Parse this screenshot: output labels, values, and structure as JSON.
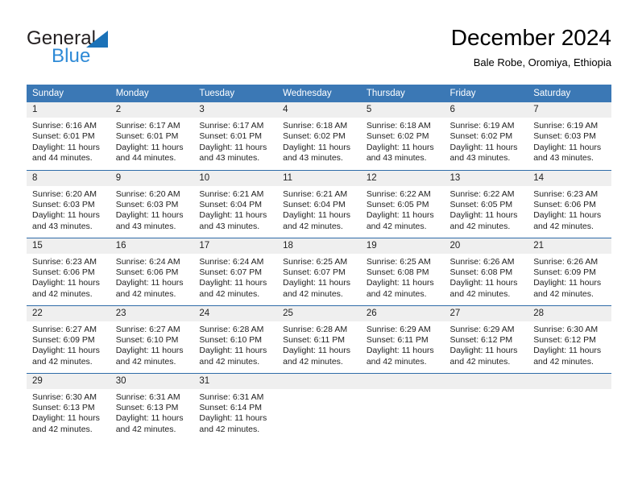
{
  "brand": {
    "name_part1": "General",
    "name_part2": "Blue"
  },
  "header": {
    "title": "December 2024",
    "subtitle": "Bale Robe, Oromiya, Ethiopia"
  },
  "colors": {
    "header_blue": "#3b78b5",
    "row_divider": "#2f6ca8",
    "daynum_bg": "#efefef",
    "brand_blue": "#2e8ad6",
    "triangle_blue": "#1b72b8"
  },
  "weekdays": [
    "Sunday",
    "Monday",
    "Tuesday",
    "Wednesday",
    "Thursday",
    "Friday",
    "Saturday"
  ],
  "weeks": [
    [
      {
        "day": "1",
        "sunrise": "Sunrise: 6:16 AM",
        "sunset": "Sunset: 6:01 PM",
        "daylight1": "Daylight: 11 hours",
        "daylight2": "and 44 minutes."
      },
      {
        "day": "2",
        "sunrise": "Sunrise: 6:17 AM",
        "sunset": "Sunset: 6:01 PM",
        "daylight1": "Daylight: 11 hours",
        "daylight2": "and 44 minutes."
      },
      {
        "day": "3",
        "sunrise": "Sunrise: 6:17 AM",
        "sunset": "Sunset: 6:01 PM",
        "daylight1": "Daylight: 11 hours",
        "daylight2": "and 43 minutes."
      },
      {
        "day": "4",
        "sunrise": "Sunrise: 6:18 AM",
        "sunset": "Sunset: 6:02 PM",
        "daylight1": "Daylight: 11 hours",
        "daylight2": "and 43 minutes."
      },
      {
        "day": "5",
        "sunrise": "Sunrise: 6:18 AM",
        "sunset": "Sunset: 6:02 PM",
        "daylight1": "Daylight: 11 hours",
        "daylight2": "and 43 minutes."
      },
      {
        "day": "6",
        "sunrise": "Sunrise: 6:19 AM",
        "sunset": "Sunset: 6:02 PM",
        "daylight1": "Daylight: 11 hours",
        "daylight2": "and 43 minutes."
      },
      {
        "day": "7",
        "sunrise": "Sunrise: 6:19 AM",
        "sunset": "Sunset: 6:03 PM",
        "daylight1": "Daylight: 11 hours",
        "daylight2": "and 43 minutes."
      }
    ],
    [
      {
        "day": "8",
        "sunrise": "Sunrise: 6:20 AM",
        "sunset": "Sunset: 6:03 PM",
        "daylight1": "Daylight: 11 hours",
        "daylight2": "and 43 minutes."
      },
      {
        "day": "9",
        "sunrise": "Sunrise: 6:20 AM",
        "sunset": "Sunset: 6:03 PM",
        "daylight1": "Daylight: 11 hours",
        "daylight2": "and 43 minutes."
      },
      {
        "day": "10",
        "sunrise": "Sunrise: 6:21 AM",
        "sunset": "Sunset: 6:04 PM",
        "daylight1": "Daylight: 11 hours",
        "daylight2": "and 43 minutes."
      },
      {
        "day": "11",
        "sunrise": "Sunrise: 6:21 AM",
        "sunset": "Sunset: 6:04 PM",
        "daylight1": "Daylight: 11 hours",
        "daylight2": "and 42 minutes."
      },
      {
        "day": "12",
        "sunrise": "Sunrise: 6:22 AM",
        "sunset": "Sunset: 6:05 PM",
        "daylight1": "Daylight: 11 hours",
        "daylight2": "and 42 minutes."
      },
      {
        "day": "13",
        "sunrise": "Sunrise: 6:22 AM",
        "sunset": "Sunset: 6:05 PM",
        "daylight1": "Daylight: 11 hours",
        "daylight2": "and 42 minutes."
      },
      {
        "day": "14",
        "sunrise": "Sunrise: 6:23 AM",
        "sunset": "Sunset: 6:06 PM",
        "daylight1": "Daylight: 11 hours",
        "daylight2": "and 42 minutes."
      }
    ],
    [
      {
        "day": "15",
        "sunrise": "Sunrise: 6:23 AM",
        "sunset": "Sunset: 6:06 PM",
        "daylight1": "Daylight: 11 hours",
        "daylight2": "and 42 minutes."
      },
      {
        "day": "16",
        "sunrise": "Sunrise: 6:24 AM",
        "sunset": "Sunset: 6:06 PM",
        "daylight1": "Daylight: 11 hours",
        "daylight2": "and 42 minutes."
      },
      {
        "day": "17",
        "sunrise": "Sunrise: 6:24 AM",
        "sunset": "Sunset: 6:07 PM",
        "daylight1": "Daylight: 11 hours",
        "daylight2": "and 42 minutes."
      },
      {
        "day": "18",
        "sunrise": "Sunrise: 6:25 AM",
        "sunset": "Sunset: 6:07 PM",
        "daylight1": "Daylight: 11 hours",
        "daylight2": "and 42 minutes."
      },
      {
        "day": "19",
        "sunrise": "Sunrise: 6:25 AM",
        "sunset": "Sunset: 6:08 PM",
        "daylight1": "Daylight: 11 hours",
        "daylight2": "and 42 minutes."
      },
      {
        "day": "20",
        "sunrise": "Sunrise: 6:26 AM",
        "sunset": "Sunset: 6:08 PM",
        "daylight1": "Daylight: 11 hours",
        "daylight2": "and 42 minutes."
      },
      {
        "day": "21",
        "sunrise": "Sunrise: 6:26 AM",
        "sunset": "Sunset: 6:09 PM",
        "daylight1": "Daylight: 11 hours",
        "daylight2": "and 42 minutes."
      }
    ],
    [
      {
        "day": "22",
        "sunrise": "Sunrise: 6:27 AM",
        "sunset": "Sunset: 6:09 PM",
        "daylight1": "Daylight: 11 hours",
        "daylight2": "and 42 minutes."
      },
      {
        "day": "23",
        "sunrise": "Sunrise: 6:27 AM",
        "sunset": "Sunset: 6:10 PM",
        "daylight1": "Daylight: 11 hours",
        "daylight2": "and 42 minutes."
      },
      {
        "day": "24",
        "sunrise": "Sunrise: 6:28 AM",
        "sunset": "Sunset: 6:10 PM",
        "daylight1": "Daylight: 11 hours",
        "daylight2": "and 42 minutes."
      },
      {
        "day": "25",
        "sunrise": "Sunrise: 6:28 AM",
        "sunset": "Sunset: 6:11 PM",
        "daylight1": "Daylight: 11 hours",
        "daylight2": "and 42 minutes."
      },
      {
        "day": "26",
        "sunrise": "Sunrise: 6:29 AM",
        "sunset": "Sunset: 6:11 PM",
        "daylight1": "Daylight: 11 hours",
        "daylight2": "and 42 minutes."
      },
      {
        "day": "27",
        "sunrise": "Sunrise: 6:29 AM",
        "sunset": "Sunset: 6:12 PM",
        "daylight1": "Daylight: 11 hours",
        "daylight2": "and 42 minutes."
      },
      {
        "day": "28",
        "sunrise": "Sunrise: 6:30 AM",
        "sunset": "Sunset: 6:12 PM",
        "daylight1": "Daylight: 11 hours",
        "daylight2": "and 42 minutes."
      }
    ],
    [
      {
        "day": "29",
        "sunrise": "Sunrise: 6:30 AM",
        "sunset": "Sunset: 6:13 PM",
        "daylight1": "Daylight: 11 hours",
        "daylight2": "and 42 minutes."
      },
      {
        "day": "30",
        "sunrise": "Sunrise: 6:31 AM",
        "sunset": "Sunset: 6:13 PM",
        "daylight1": "Daylight: 11 hours",
        "daylight2": "and 42 minutes."
      },
      {
        "day": "31",
        "sunrise": "Sunrise: 6:31 AM",
        "sunset": "Sunset: 6:14 PM",
        "daylight1": "Daylight: 11 hours",
        "daylight2": "and 42 minutes."
      },
      {
        "day": "",
        "sunrise": "",
        "sunset": "",
        "daylight1": "",
        "daylight2": ""
      },
      {
        "day": "",
        "sunrise": "",
        "sunset": "",
        "daylight1": "",
        "daylight2": ""
      },
      {
        "day": "",
        "sunrise": "",
        "sunset": "",
        "daylight1": "",
        "daylight2": ""
      },
      {
        "day": "",
        "sunrise": "",
        "sunset": "",
        "daylight1": "",
        "daylight2": ""
      }
    ]
  ]
}
